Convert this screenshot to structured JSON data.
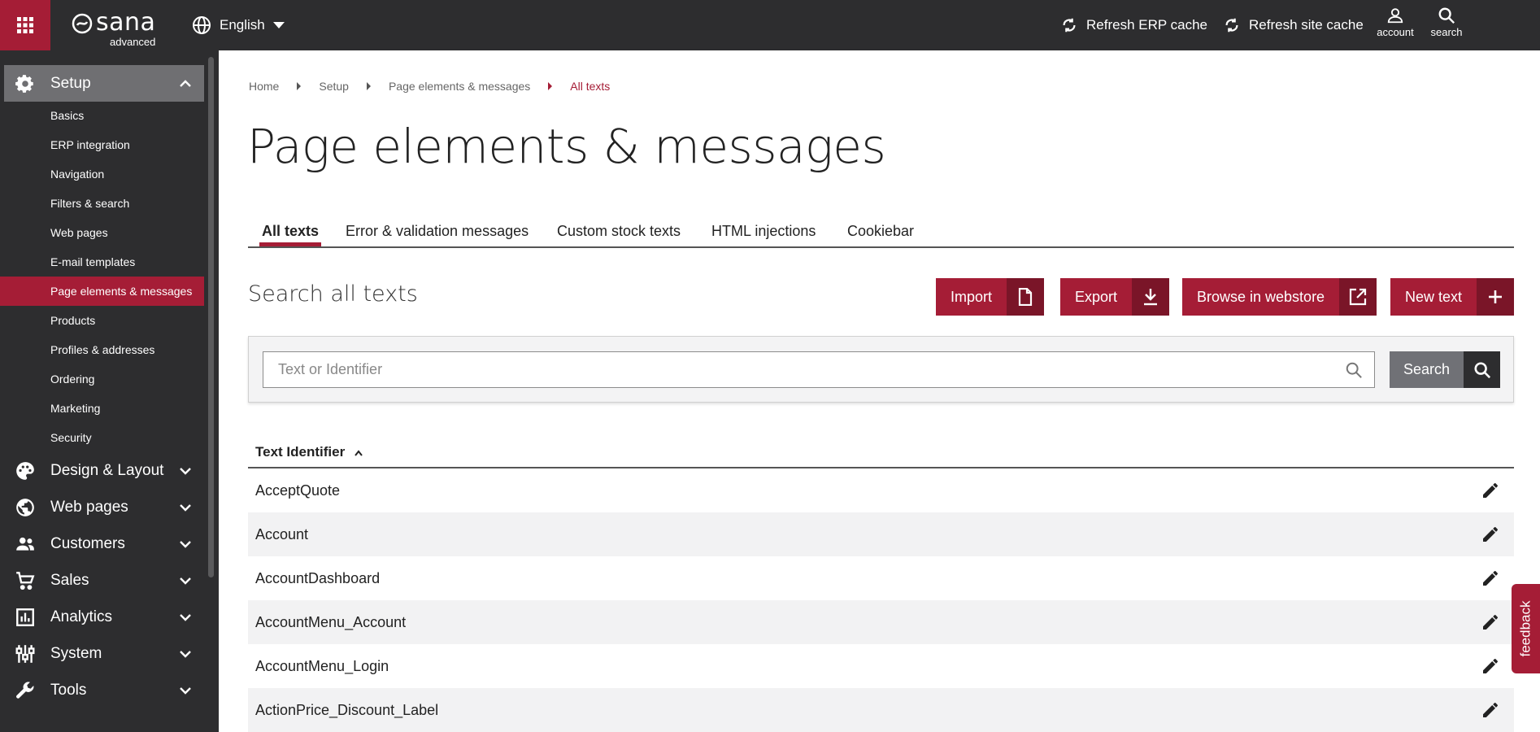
{
  "header": {
    "logo_text": "sana",
    "logo_sub": "advanced",
    "language": "English",
    "refresh_erp": "Refresh ERP cache",
    "refresh_site": "Refresh site cache",
    "account": "account",
    "search": "search"
  },
  "sidebar": {
    "setup": {
      "label": "Setup",
      "items": [
        {
          "label": "Basics"
        },
        {
          "label": "ERP integration"
        },
        {
          "label": "Navigation"
        },
        {
          "label": "Filters & search"
        },
        {
          "label": "Web pages"
        },
        {
          "label": "E-mail templates"
        },
        {
          "label": "Page elements & messages"
        },
        {
          "label": "Products"
        },
        {
          "label": "Profiles & addresses"
        },
        {
          "label": "Ordering"
        },
        {
          "label": "Marketing"
        },
        {
          "label": "Security"
        }
      ]
    },
    "sections": [
      {
        "label": "Design & Layout"
      },
      {
        "label": "Web pages"
      },
      {
        "label": "Customers"
      },
      {
        "label": "Sales"
      },
      {
        "label": "Analytics"
      },
      {
        "label": "System"
      },
      {
        "label": "Tools"
      }
    ]
  },
  "breadcrumb": [
    "Home",
    "Setup",
    "Page elements & messages",
    "All texts"
  ],
  "page_title": "Page elements & messages",
  "tabs": [
    "All texts",
    "Error & validation messages",
    "Custom stock texts",
    "HTML injections",
    "Cookiebar"
  ],
  "search_section": {
    "title": "Search all texts",
    "import": "Import",
    "export": "Export",
    "browse": "Browse in webstore",
    "new_text": "New text",
    "placeholder": "Text or Identifier",
    "search_button": "Search"
  },
  "table": {
    "header": "Text Identifier",
    "rows": [
      "AcceptQuote",
      "Account",
      "AccountDashboard",
      "AccountMenu_Account",
      "AccountMenu_Login",
      "ActionPrice_Discount_Label"
    ]
  },
  "feedback": "feedback",
  "colors": {
    "accent": "#a51d36",
    "dark": "#2d2d2f"
  }
}
